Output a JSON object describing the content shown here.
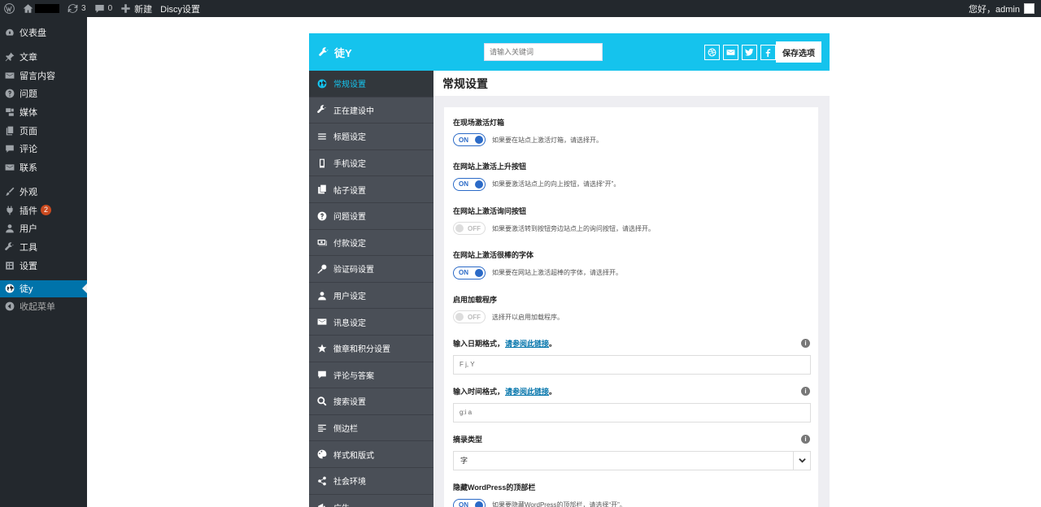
{
  "admin_bar": {
    "updates_count": "3",
    "comments_count": "0",
    "new_label": "新建",
    "theme_settings_label": "Discy设置",
    "greeting": "您好，admin"
  },
  "admin_menu": {
    "items": [
      {
        "label": "仪表盘",
        "icon": "dashboard-icon"
      },
      {
        "label": "文章",
        "icon": "pin-icon"
      },
      {
        "label": "留言内容",
        "icon": "envelope-icon"
      },
      {
        "label": "问题",
        "icon": "question-icon"
      },
      {
        "label": "媒体",
        "icon": "media-icon"
      },
      {
        "label": "页面",
        "icon": "pages-icon"
      },
      {
        "label": "评论",
        "icon": "comment-icon"
      },
      {
        "label": "联系",
        "icon": "envelope-icon"
      },
      {
        "label": "外观",
        "icon": "brush-icon"
      },
      {
        "label": "插件",
        "icon": "plugin-icon",
        "badge": "2"
      },
      {
        "label": "用户",
        "icon": "user-icon"
      },
      {
        "label": "工具",
        "icon": "wrench-icon"
      },
      {
        "label": "设置",
        "icon": "settings-icon"
      },
      {
        "label": "徒y",
        "icon": "globe-icon"
      },
      {
        "label": "收起菜单",
        "icon": "collapse-icon"
      }
    ]
  },
  "panel": {
    "title": "徒Y",
    "search_placeholder": "请输入关键词",
    "save_label": "保存选项",
    "social_icons": [
      "dribbble-icon",
      "email-icon",
      "twitter-icon",
      "facebook-icon"
    ],
    "accent_color": "#15c3ed"
  },
  "nav": {
    "items": [
      {
        "label": "常规设置",
        "icon": "globe-icon"
      },
      {
        "label": "正在建设中",
        "icon": "wrench-icon"
      },
      {
        "label": "标题设定",
        "icon": "menu-icon"
      },
      {
        "label": "手机设定",
        "icon": "mobile-icon"
      },
      {
        "label": "帖子设置",
        "icon": "copy-icon"
      },
      {
        "label": "问题设置",
        "icon": "question-icon"
      },
      {
        "label": "付款设定",
        "icon": "money-icon"
      },
      {
        "label": "验证码设置",
        "icon": "key-icon"
      },
      {
        "label": "用户设定",
        "icon": "user-icon"
      },
      {
        "label": "讯息设定",
        "icon": "envelope-icon"
      },
      {
        "label": "徽章和积分设置",
        "icon": "star-icon"
      },
      {
        "label": "评论与答案",
        "icon": "comment-icon"
      },
      {
        "label": "搜索设置",
        "icon": "search-icon"
      },
      {
        "label": "侧边栏",
        "icon": "sidebar-icon"
      },
      {
        "label": "样式和版式",
        "icon": "palette-icon"
      },
      {
        "label": "社会环境",
        "icon": "share-icon"
      },
      {
        "label": "广告",
        "icon": "ad-icon"
      }
    ]
  },
  "main": {
    "title": "常规设置",
    "toggles": [
      {
        "label": "在现场激活灯箱",
        "state": "ON",
        "desc": "如果要在站点上激活灯箱，请选择开。"
      },
      {
        "label": "在网站上激活上升按钮",
        "state": "ON",
        "desc": "如果要激活站点上的向上按钮，请选择“开”。"
      },
      {
        "label": "在网站上激活询问按钮",
        "state": "OFF",
        "desc": "如果要激活转到按钮旁边站点上的询问按钮，请选择开。"
      },
      {
        "label": "在网站上激活很棒的字体",
        "state": "ON",
        "desc": "如果要在网站上激活超棒的字体，请选择开。"
      },
      {
        "label": "启用加载程序",
        "state": "OFF",
        "desc": "选择开以启用加载程序。"
      }
    ],
    "date_format": {
      "label": "输入日期格式，",
      "link": "请参阅此链接",
      "suffix": "。",
      "value": "F j, Y"
    },
    "time_format": {
      "label": "输入时间格式，",
      "link": "请参阅此链接",
      "suffix": "。",
      "value": "g:i a"
    },
    "excerpt_type": {
      "label": "摘录类型",
      "value": "字"
    },
    "hide_topbar": {
      "label": "隐藏WordPress的顶部栏",
      "state": "ON",
      "desc": "如果要隐藏WordPress的顶部栏，请选择“开”。"
    }
  }
}
